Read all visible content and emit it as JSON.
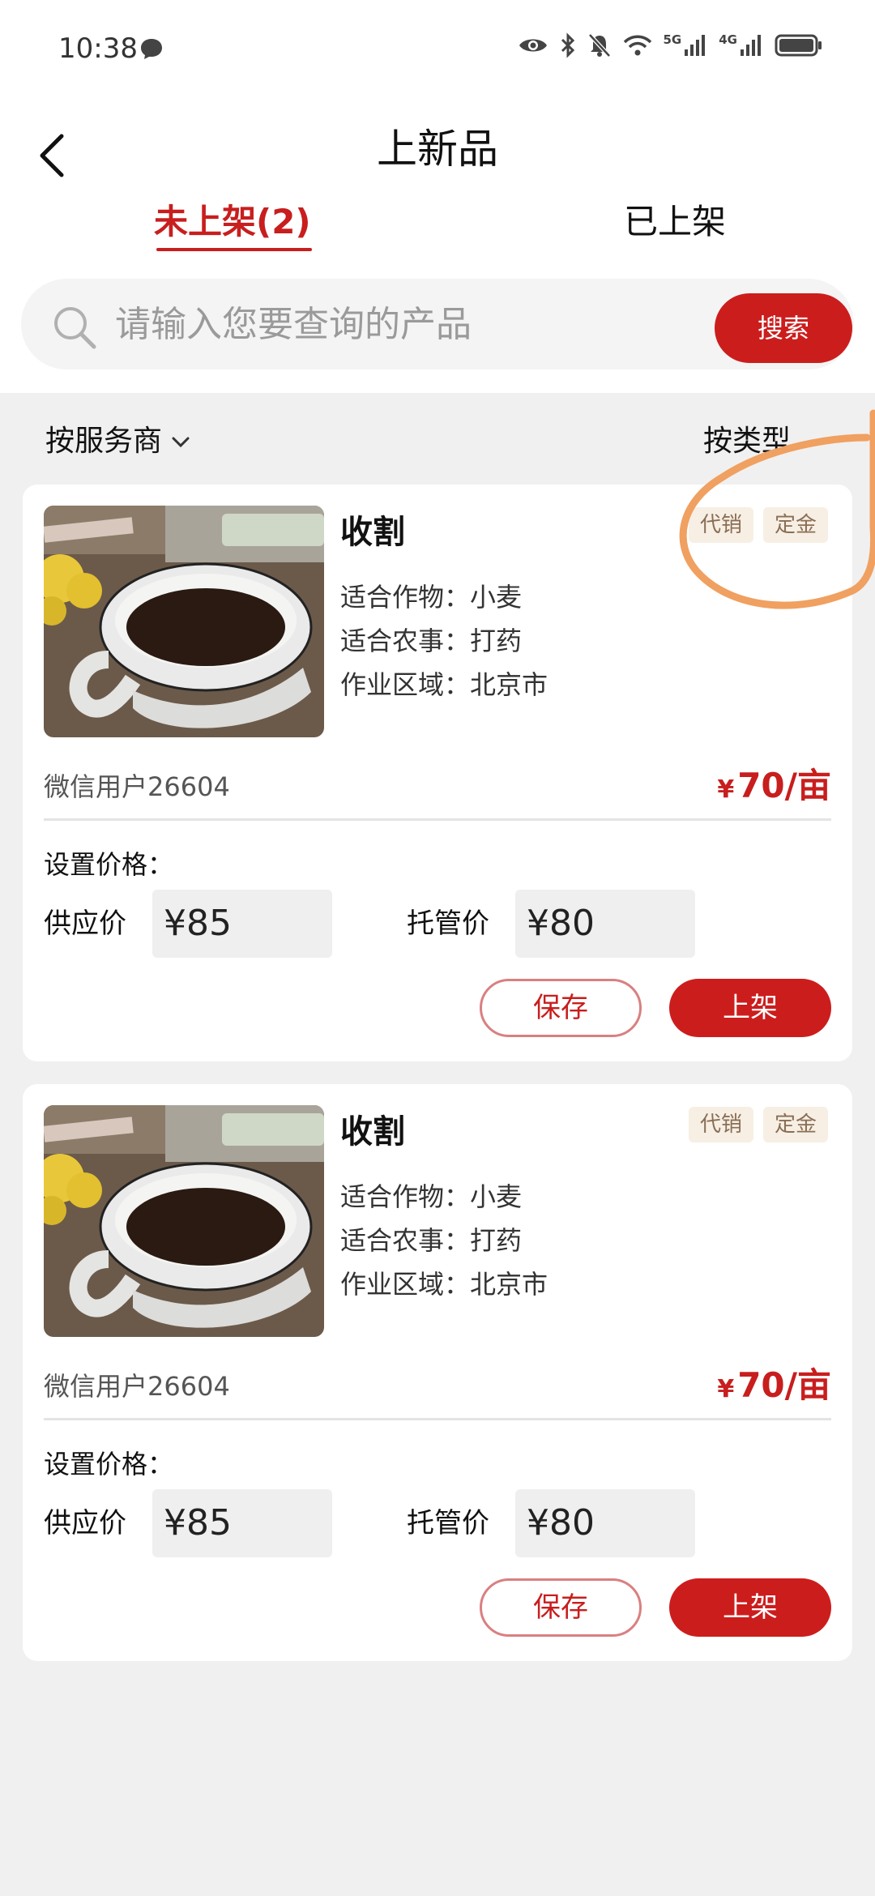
{
  "status_bar": {
    "time": "10:38",
    "icons": [
      "chat-icon",
      "eye-icon",
      "bluetooth-icon",
      "mute-icon",
      "wifi-icon",
      "signal-5g-icon",
      "signal-4g-icon",
      "battery-icon"
    ],
    "net1": "5G",
    "net2": "4G"
  },
  "header": {
    "title": "上新品",
    "tabs": [
      {
        "label": "未上架(2)",
        "active": true
      },
      {
        "label": "已上架",
        "active": false
      }
    ]
  },
  "search": {
    "placeholder": "请输入您要查询的产品",
    "button": "搜索"
  },
  "filters": {
    "provider": "按服务商",
    "type": "按类型"
  },
  "products": [
    {
      "name": "收割",
      "tags": [
        "代销",
        "定金"
      ],
      "crop": "适合作物：小麦",
      "farming": "适合农事：打药",
      "area": "作业区域：北京市",
      "seller": "微信用户26604",
      "price_symbol": "¥",
      "price": "70/亩",
      "set_price_label": "设置价格：",
      "supply_label": "供应价",
      "supply_value": "¥85",
      "custody_label": "托管价",
      "custody_value": "¥80",
      "save_label": "保存",
      "list_label": "上架"
    },
    {
      "name": "收割",
      "tags": [
        "代销",
        "定金"
      ],
      "crop": "适合作物：小麦",
      "farming": "适合农事：打药",
      "area": "作业区域：北京市",
      "seller": "微信用户26604",
      "price_symbol": "¥",
      "price": "70/亩",
      "set_price_label": "设置价格：",
      "supply_label": "供应价",
      "supply_value": "¥85",
      "custody_label": "托管价",
      "custody_value": "¥80",
      "save_label": "保存",
      "list_label": "上架"
    }
  ],
  "colors": {
    "accent": "#cc1d1d",
    "tag_bg": "#f7efe4",
    "tag_text": "#8a6e55",
    "annotation": "#f0a060"
  }
}
